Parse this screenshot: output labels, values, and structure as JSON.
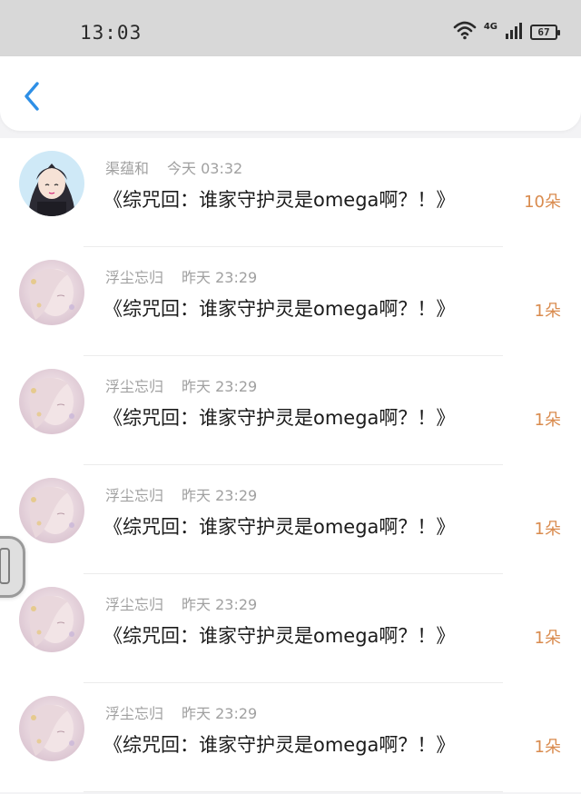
{
  "status_bar": {
    "time": "13:03",
    "network": "4G",
    "battery": "67"
  },
  "header": {
    "back_icon": "chevron-left-icon",
    "accent_color": "#2e8fe6"
  },
  "list": {
    "items": [
      {
        "name": "渠蕴和",
        "time": "今天 03:32",
        "title": "《综咒回：谁家守护灵是omega啊？！》",
        "count": "10朵",
        "avatar": "avatar-dark-hair"
      },
      {
        "name": "浮尘忘归",
        "time": "昨天 23:29",
        "title": "《综咒回：谁家守护灵是omega啊？！》",
        "count": "1朵",
        "avatar": "avatar-pale-hair"
      },
      {
        "name": "浮尘忘归",
        "time": "昨天 23:29",
        "title": "《综咒回：谁家守护灵是omega啊？！》",
        "count": "1朵",
        "avatar": "avatar-pale-hair"
      },
      {
        "name": "浮尘忘归",
        "time": "昨天 23:29",
        "title": "《综咒回：谁家守护灵是omega啊？！》",
        "count": "1朵",
        "avatar": "avatar-pale-hair"
      },
      {
        "name": "浮尘忘归",
        "time": "昨天 23:29",
        "title": "《综咒回：谁家守护灵是omega啊？！》",
        "count": "1朵",
        "avatar": "avatar-pale-hair"
      },
      {
        "name": "浮尘忘归",
        "time": "昨天 23:29",
        "title": "《综咒回：谁家守护灵是omega啊？！》",
        "count": "1朵",
        "avatar": "avatar-pale-hair"
      }
    ]
  },
  "colors": {
    "count": "#d98b4e",
    "meta": "#a0a0a0",
    "title": "#1b1b1b"
  }
}
